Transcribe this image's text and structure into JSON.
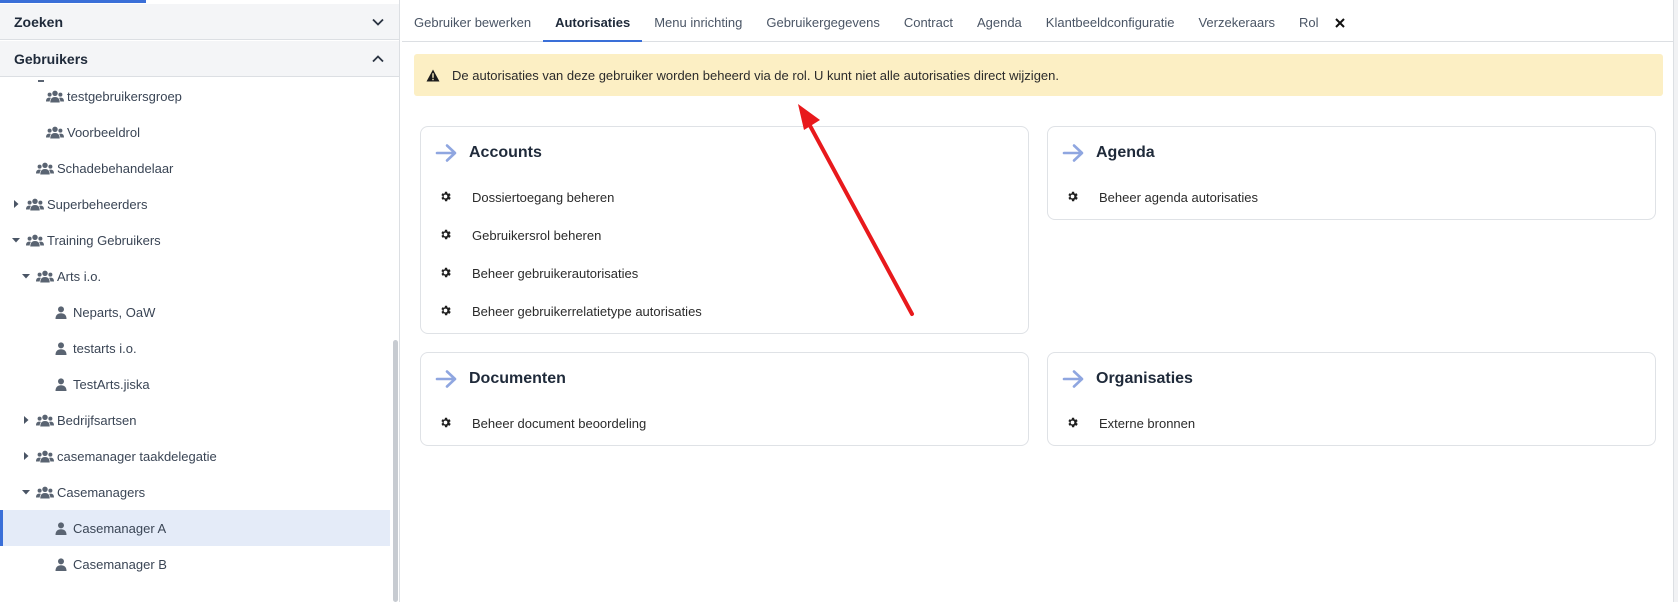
{
  "sidebar": {
    "sections": {
      "zoeken": "Zoeken",
      "gebruikers": "Gebruikers"
    },
    "tree": [
      {
        "label": "testgebruikersgroep",
        "icon": "users-icon",
        "level": 2,
        "toggle": "none"
      },
      {
        "label": "Voorbeeldrol",
        "icon": "users-icon",
        "level": 2,
        "toggle": "none"
      },
      {
        "label": "Schadebehandelaar",
        "icon": "users-icon",
        "level": 1,
        "toggle": "none"
      },
      {
        "label": "Superbeheerders",
        "icon": "users-icon",
        "level": 0,
        "toggle": "collapsed"
      },
      {
        "label": "Training Gebruikers",
        "icon": "users-icon",
        "level": 0,
        "toggle": "expanded"
      },
      {
        "label": "Arts i.o.",
        "icon": "users-icon",
        "level": 1,
        "toggle": "expanded"
      },
      {
        "label": "Neparts, OaW",
        "icon": "user-icon",
        "level": 2,
        "toggle": "none"
      },
      {
        "label": "testarts i.o.",
        "icon": "user-icon",
        "level": 2,
        "toggle": "none"
      },
      {
        "label": "TestArts.jiska",
        "icon": "user-icon",
        "level": 2,
        "toggle": "none"
      },
      {
        "label": "Bedrijfsartsen",
        "icon": "users-icon",
        "level": 1,
        "toggle": "collapsed"
      },
      {
        "label": "casemanager taakdelegatie",
        "icon": "users-icon",
        "level": 1,
        "toggle": "collapsed"
      },
      {
        "label": "Casemanagers",
        "icon": "users-icon",
        "level": 1,
        "toggle": "expanded"
      },
      {
        "label": "Casemanager A",
        "icon": "user-icon",
        "level": 2,
        "toggle": "none",
        "selected": true
      },
      {
        "label": "Casemanager B",
        "icon": "user-icon",
        "level": 2,
        "toggle": "none"
      }
    ]
  },
  "tabs": [
    {
      "label": "Gebruiker bewerken",
      "active": false
    },
    {
      "label": "Autorisaties",
      "active": true
    },
    {
      "label": "Menu inrichting",
      "active": false
    },
    {
      "label": "Gebruikergegevens",
      "active": false
    },
    {
      "label": "Contract",
      "active": false
    },
    {
      "label": "Agenda",
      "active": false
    },
    {
      "label": "Klantbeeldconfiguratie",
      "active": false
    },
    {
      "label": "Verzekeraars",
      "active": false
    },
    {
      "label": "Rol",
      "active": false
    }
  ],
  "warning": {
    "text": "De autorisaties van deze gebruiker worden beheerd via de rol. U kunt niet alle autorisaties direct wijzigen."
  },
  "cards": {
    "accounts": {
      "title": "Accounts",
      "items": [
        "Dossiertoegang beheren",
        "Gebruikersrol beheren",
        "Beheer gebruikerautorisaties",
        "Beheer gebruikerrelatietype autorisaties"
      ]
    },
    "agenda": {
      "title": "Agenda",
      "items": [
        "Beheer agenda autorisaties"
      ]
    },
    "documenten": {
      "title": "Documenten",
      "items": [
        "Beheer document beoordeling"
      ]
    },
    "organisaties": {
      "title": "Organisaties",
      "items": [
        "Externe bronnen"
      ]
    }
  },
  "colors": {
    "accent": "#3a6fd8",
    "warning_bg": "#fcefc4",
    "annotation": "#e8191c",
    "card_arrow": "#8fa6e0"
  }
}
